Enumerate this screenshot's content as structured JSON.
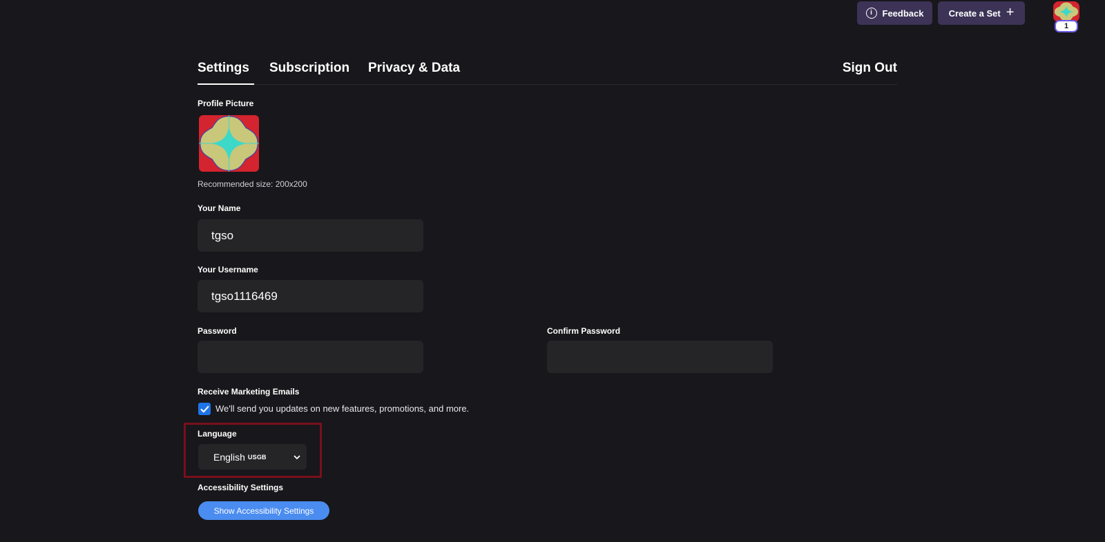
{
  "header": {
    "feedback_label": "Feedback",
    "feedback_icon": "info-icon",
    "create_set_label": "Create a Set",
    "create_set_icon": "plus-icon",
    "avatar_badge": "1"
  },
  "tabs": [
    {
      "label": "Settings",
      "active": true
    },
    {
      "label": "Subscription",
      "active": false
    },
    {
      "label": "Privacy & Data",
      "active": false
    }
  ],
  "sign_out_label": "Sign Out",
  "profile": {
    "label": "Profile Picture",
    "hint": "Recommended size: 200x200"
  },
  "name": {
    "label": "Your Name",
    "value": "tgso"
  },
  "username": {
    "label": "Your Username",
    "value": "tgso1116469"
  },
  "password": {
    "label": "Password",
    "value": ""
  },
  "confirm_password": {
    "label": "Confirm Password",
    "value": ""
  },
  "marketing": {
    "label": "Receive Marketing Emails",
    "checked": true,
    "description": "We'll send you updates on new features, promotions, and more."
  },
  "language": {
    "label": "Language",
    "selected": "English",
    "selected_suffix": "USGB"
  },
  "accessibility": {
    "label": "Accessibility Settings",
    "button_label": "Show Accessibility Settings"
  },
  "colors": {
    "background": "#18171b",
    "header_button": "#3c3356",
    "input_background": "#252528",
    "checkbox": "#1f74e8",
    "accessibility_button": "#4a8cf0",
    "highlight_box": "#7a0f1d",
    "avatar_red": "#d4242f",
    "avatar_tan": "#c9c77a",
    "avatar_cyan": "#3ed8c8"
  }
}
